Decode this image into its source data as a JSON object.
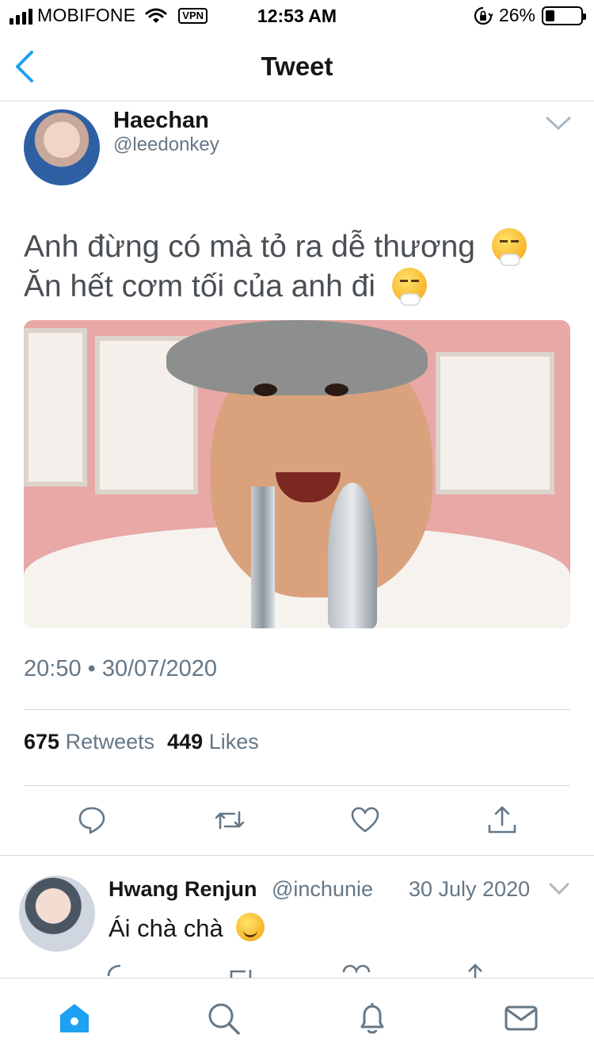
{
  "status_bar": {
    "carrier": "MOBIFONE",
    "vpn": "VPN",
    "time": "12:53 AM",
    "battery": "26%",
    "battery_level": 0.26
  },
  "nav": {
    "title": "Tweet",
    "back_icon": "chevron-left-icon"
  },
  "tweet": {
    "author_name": "Haechan",
    "author_handle": "@leedonkey",
    "line1": "Anh đừng có mà tỏ ra dễ thương",
    "line2": "Ăn hết cơm tối của anh đi",
    "emoji": "face-with-steam-from-nose-icon",
    "timestamp": "20:50 • 30/07/2020",
    "retweets_count": "675",
    "retweets_label": "Retweets",
    "likes_count": "449",
    "likes_label": "Likes",
    "actions": [
      "reply-icon",
      "retweet-icon",
      "like-icon",
      "share-icon"
    ]
  },
  "reply": {
    "author_name": "Hwang Renjun",
    "author_handle": "@inchunie",
    "date": "30 July 2020",
    "text": "Ái chà chà",
    "emoji": "winking-face-icon"
  },
  "tabbar": {
    "tabs": [
      "home-icon",
      "search-icon",
      "notifications-icon",
      "messages-icon"
    ],
    "active_color": "#1da1f2",
    "inactive_color": "#657786"
  }
}
